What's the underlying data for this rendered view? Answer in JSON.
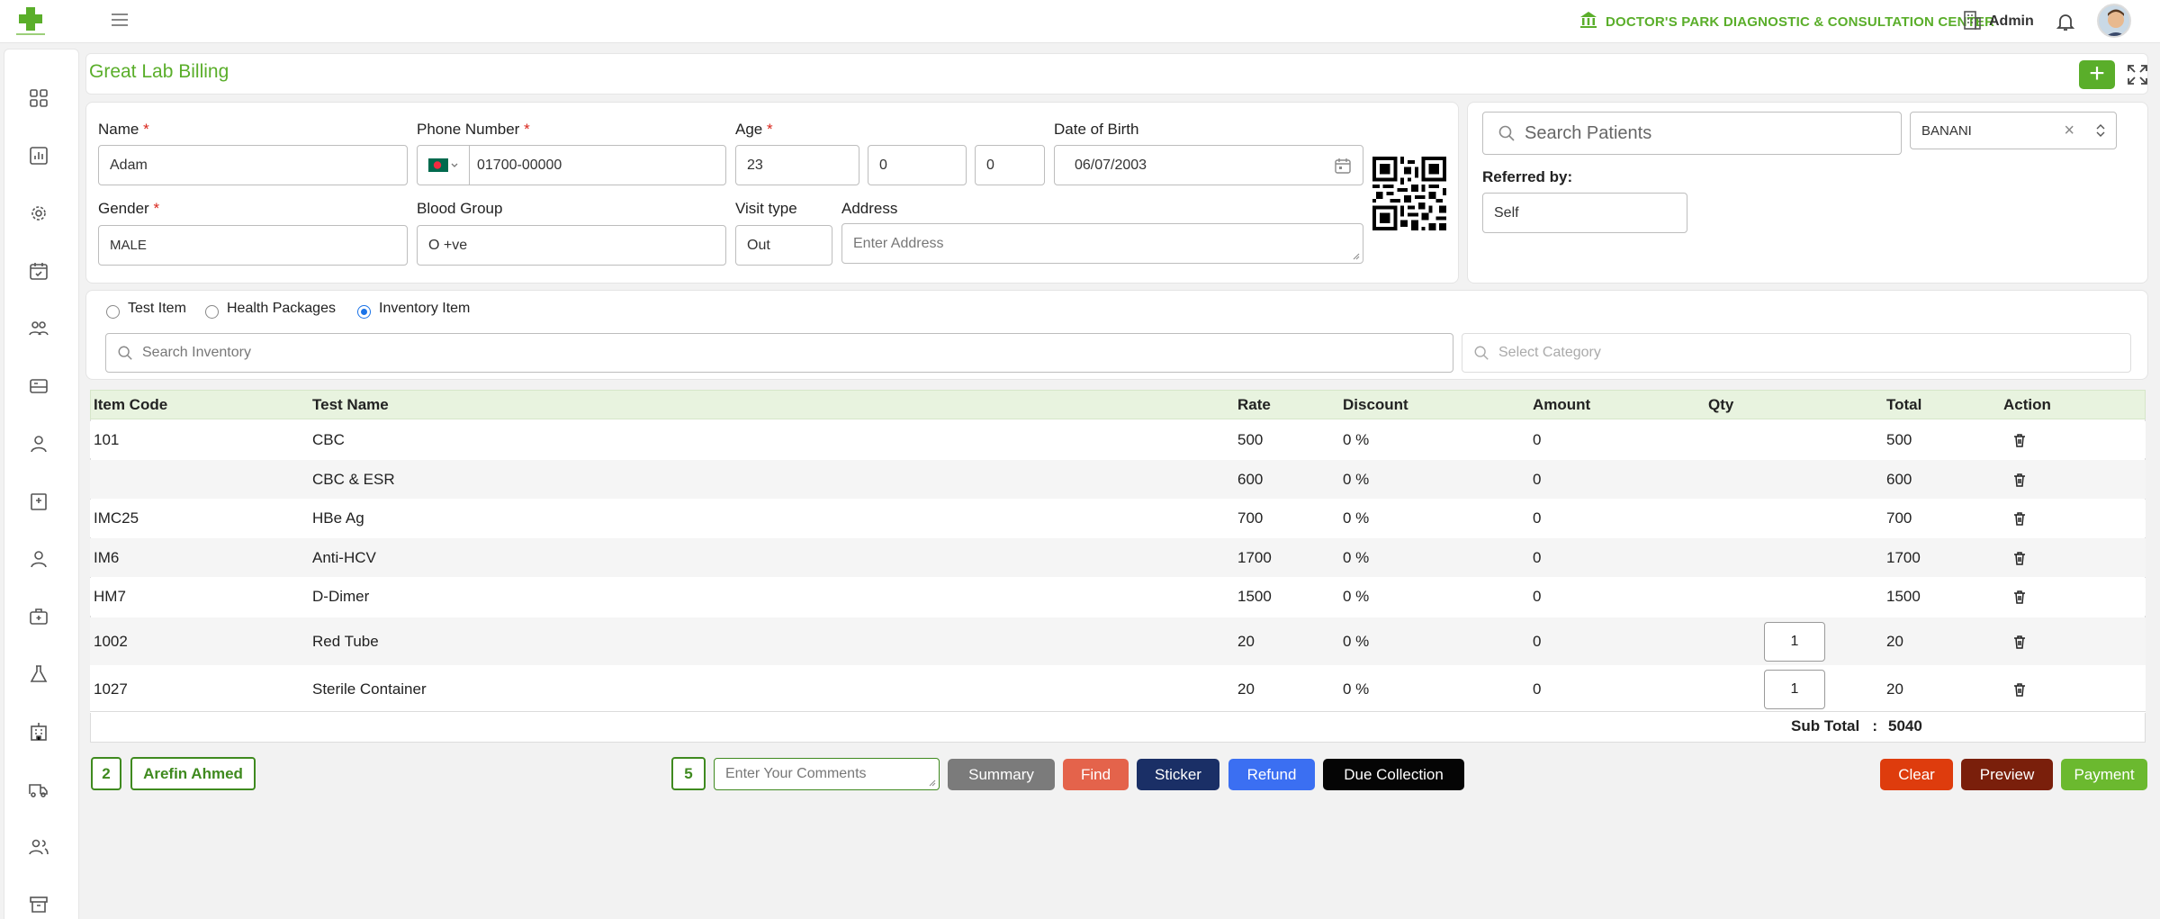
{
  "header": {
    "center_name": "DOCTOR'S PARK DIAGNOSTIC & CONSULTATION CENTER",
    "user": "Admin"
  },
  "page": {
    "title": "Great Lab Billing"
  },
  "patient": {
    "name_label": "Name",
    "name_value": "Adam",
    "phone_label": "Phone Number",
    "phone_value": "01700-00000",
    "age_label": "Age",
    "age_years": "23",
    "age_months": "0",
    "age_days": "0",
    "dob_label": "Date of Birth",
    "dob_value": "06/07/2003",
    "gender_label": "Gender",
    "gender_value": "MALE",
    "blood_label": "Blood Group",
    "blood_value": "O +ve",
    "visit_label": "Visit type",
    "visit_value": "Out",
    "address_label": "Address",
    "address_placeholder": "Enter Address"
  },
  "right_panel": {
    "search_placeholder": "Search Patients",
    "branch": "BANANI",
    "referred_label": "Referred by:",
    "referred_value": "Self"
  },
  "item_types": [
    {
      "label": "Test Item",
      "selected": false
    },
    {
      "label": "Health Packages",
      "selected": false
    },
    {
      "label": "Inventory Item",
      "selected": true
    }
  ],
  "search": {
    "inventory_placeholder": "Search Inventory",
    "category_placeholder": "Select Category"
  },
  "table": {
    "headers": [
      "Item Code",
      "Test Name",
      "Rate",
      "Discount",
      "Amount",
      "Qty",
      "Total",
      "Action"
    ],
    "rows": [
      {
        "code": "101",
        "name": "CBC",
        "rate": "500",
        "discount": "0 %",
        "amount": "0",
        "qty": "",
        "total": "500"
      },
      {
        "code": "",
        "name": "CBC & ESR",
        "rate": "600",
        "discount": "0 %",
        "amount": "0",
        "qty": "",
        "total": "600"
      },
      {
        "code": "IMC25",
        "name": "HBe Ag",
        "rate": "700",
        "discount": "0 %",
        "amount": "0",
        "qty": "",
        "total": "700"
      },
      {
        "code": "IM6",
        "name": "Anti-HCV",
        "rate": "1700",
        "discount": "0 %",
        "amount": "0",
        "qty": "",
        "total": "1700"
      },
      {
        "code": "HM7",
        "name": "D-Dimer",
        "rate": "1500",
        "discount": "0 %",
        "amount": "0",
        "qty": "",
        "total": "1500"
      },
      {
        "code": "1002",
        "name": "Red Tube",
        "rate": "20",
        "discount": "0 %",
        "amount": "0",
        "qty": "1",
        "total": "20"
      },
      {
        "code": "1027",
        "name": "Sterile Container",
        "rate": "20",
        "discount": "0 %",
        "amount": "0",
        "qty": "1",
        "total": "20"
      }
    ],
    "subtotal_label": "Sub Total",
    "subtotal_value": "5040"
  },
  "footer": {
    "count_badge": "2",
    "doctor": "Arefin Ahmed",
    "item_count": "5",
    "comments_placeholder": "Enter Your Comments",
    "buttons": {
      "summary": "Summary",
      "find": "Find",
      "sticker": "Sticker",
      "refund": "Refund",
      "due": "Due Collection",
      "clear": "Clear",
      "preview": "Preview",
      "payment": "Payment"
    }
  },
  "colors": {
    "brand_green": "#5aae2a",
    "header_row": "#e8f3df"
  }
}
